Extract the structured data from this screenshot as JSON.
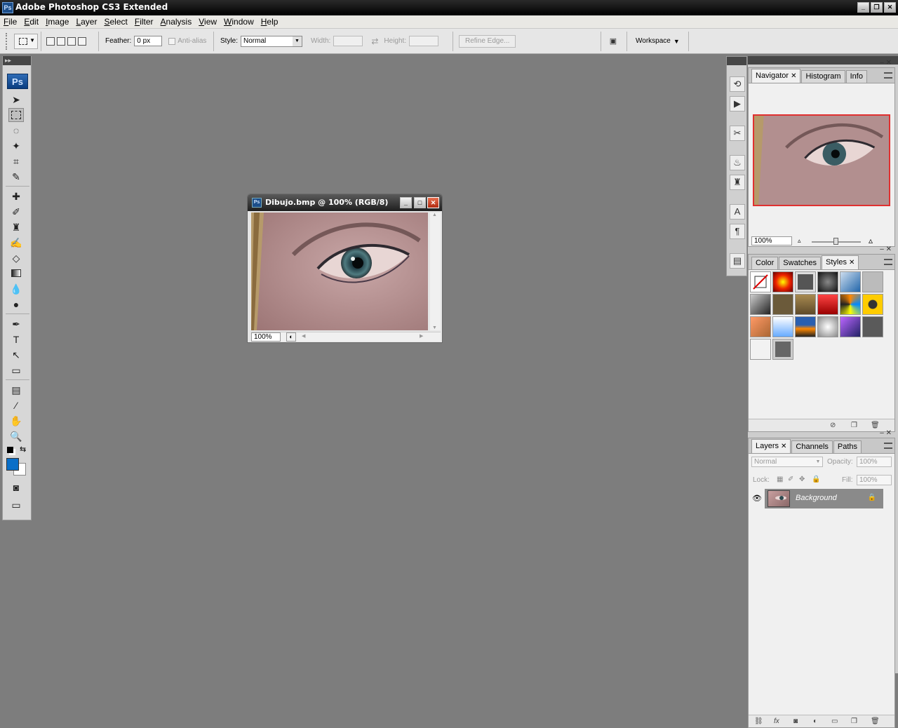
{
  "app": {
    "title": "Adobe Photoshop CS3 Extended",
    "icon_text": "Ps"
  },
  "menu": [
    "File",
    "Edit",
    "Image",
    "Layer",
    "Select",
    "Filter",
    "Analysis",
    "View",
    "Window",
    "Help"
  ],
  "options": {
    "feather_label": "Feather:",
    "feather_value": "0 px",
    "antialias_label": "Anti-alias",
    "style_label": "Style:",
    "style_value": "Normal",
    "width_label": "Width:",
    "height_label": "Height:",
    "refine_edge": "Refine Edge...",
    "workspace": "Workspace"
  },
  "toolbox": {
    "logo": "Ps",
    "foreground_color": "#0a6fc8",
    "background_color": "#ffffff"
  },
  "document": {
    "title": "Dibujo.bmp @ 100% (RGB/8)",
    "zoom": "100%"
  },
  "navigator": {
    "tabs": [
      "Navigator",
      "Histogram",
      "Info"
    ],
    "zoom": "100%",
    "view_box_color": "#e03030"
  },
  "styles_panel": {
    "tabs": [
      "Color",
      "Swatches",
      "Styles"
    ]
  },
  "layers_panel": {
    "tabs": [
      "Layers",
      "Channels",
      "Paths"
    ],
    "blend_mode": "Normal",
    "opacity_label": "Opacity:",
    "opacity_value": "100%",
    "lock_label": "Lock:",
    "fill_label": "Fill:",
    "fill_value": "100%",
    "layers": [
      {
        "name": "Background"
      }
    ]
  }
}
